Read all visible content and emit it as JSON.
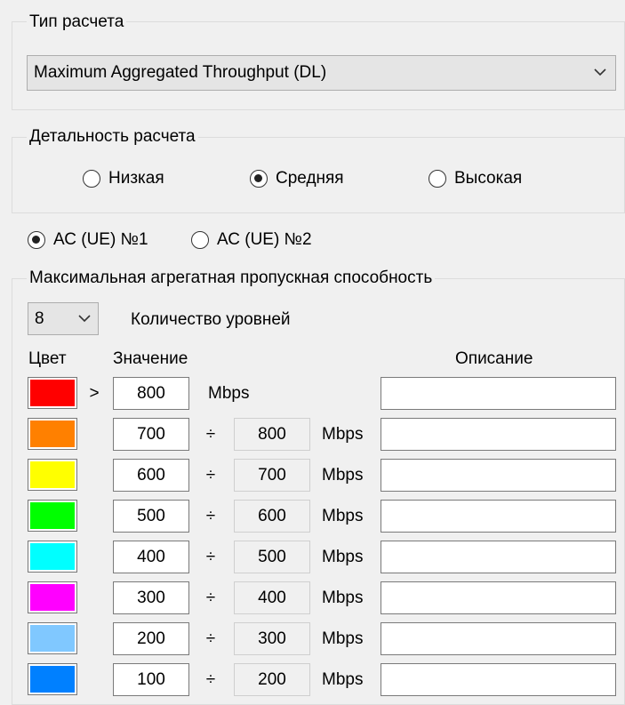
{
  "calc_type": {
    "title": "Тип расчета",
    "selected": "Maximum Aggregated Throughput (DL)"
  },
  "detail": {
    "title": "Детальность расчета",
    "options": [
      "Низкая",
      "Средняя",
      "Высокая"
    ],
    "selected": "Средняя"
  },
  "terminal": {
    "options": [
      "АС (UE) №1",
      "АС (UE) №2"
    ],
    "selected": "АС (UE) №1"
  },
  "levels": {
    "title": "Максимальная агрегатная пропускная способность",
    "count": "8",
    "count_label": "Количество уровней",
    "headers": {
      "color": "Цвет",
      "value": "Значение",
      "description": "Описание"
    },
    "gt_symbol": ">",
    "range_symbol": "÷",
    "unit": "Mbps",
    "rows": [
      {
        "color": "#ff0000",
        "from": "800",
        "to": "",
        "description": ""
      },
      {
        "color": "#ff8000",
        "from": "700",
        "to": "800",
        "description": ""
      },
      {
        "color": "#ffff00",
        "from": "600",
        "to": "700",
        "description": ""
      },
      {
        "color": "#00ff00",
        "from": "500",
        "to": "600",
        "description": ""
      },
      {
        "color": "#00ffff",
        "from": "400",
        "to": "500",
        "description": ""
      },
      {
        "color": "#ff00ff",
        "from": "300",
        "to": "400",
        "description": ""
      },
      {
        "color": "#80c8ff",
        "from": "200",
        "to": "300",
        "description": ""
      },
      {
        "color": "#0080ff",
        "from": "100",
        "to": "200",
        "description": ""
      }
    ]
  }
}
